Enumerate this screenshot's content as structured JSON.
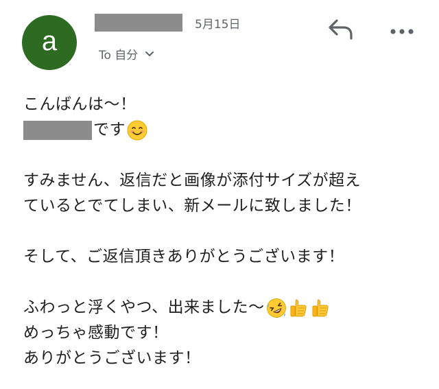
{
  "header": {
    "avatar_letter": "a",
    "avatar_color": "#2e6b22",
    "date": "5月15日",
    "recipient": "To 自分",
    "reply_icon": "reply-icon",
    "more_icon": "more-horizontal-icon",
    "chevron_icon": "chevron-down-icon"
  },
  "body": {
    "line1": "こんばんは〜！",
    "line2_suffix": "です",
    "line3": "すみません、返信だと画像が添付サイズが超え",
    "line4": "ているとでてしまい、新メールに致しました！",
    "line5": "そして、ご返信頂きありがとうございます！",
    "line6": "ふわっと浮くやつ、出来ました〜",
    "line7": "めっちゃ感動です！",
    "line8": "ありがとうございます！",
    "emojis": [
      "smiling-face-emoji",
      "rolling-laughing-emoji",
      "thumbs-up-emoji",
      "thumbs-up-emoji"
    ]
  }
}
